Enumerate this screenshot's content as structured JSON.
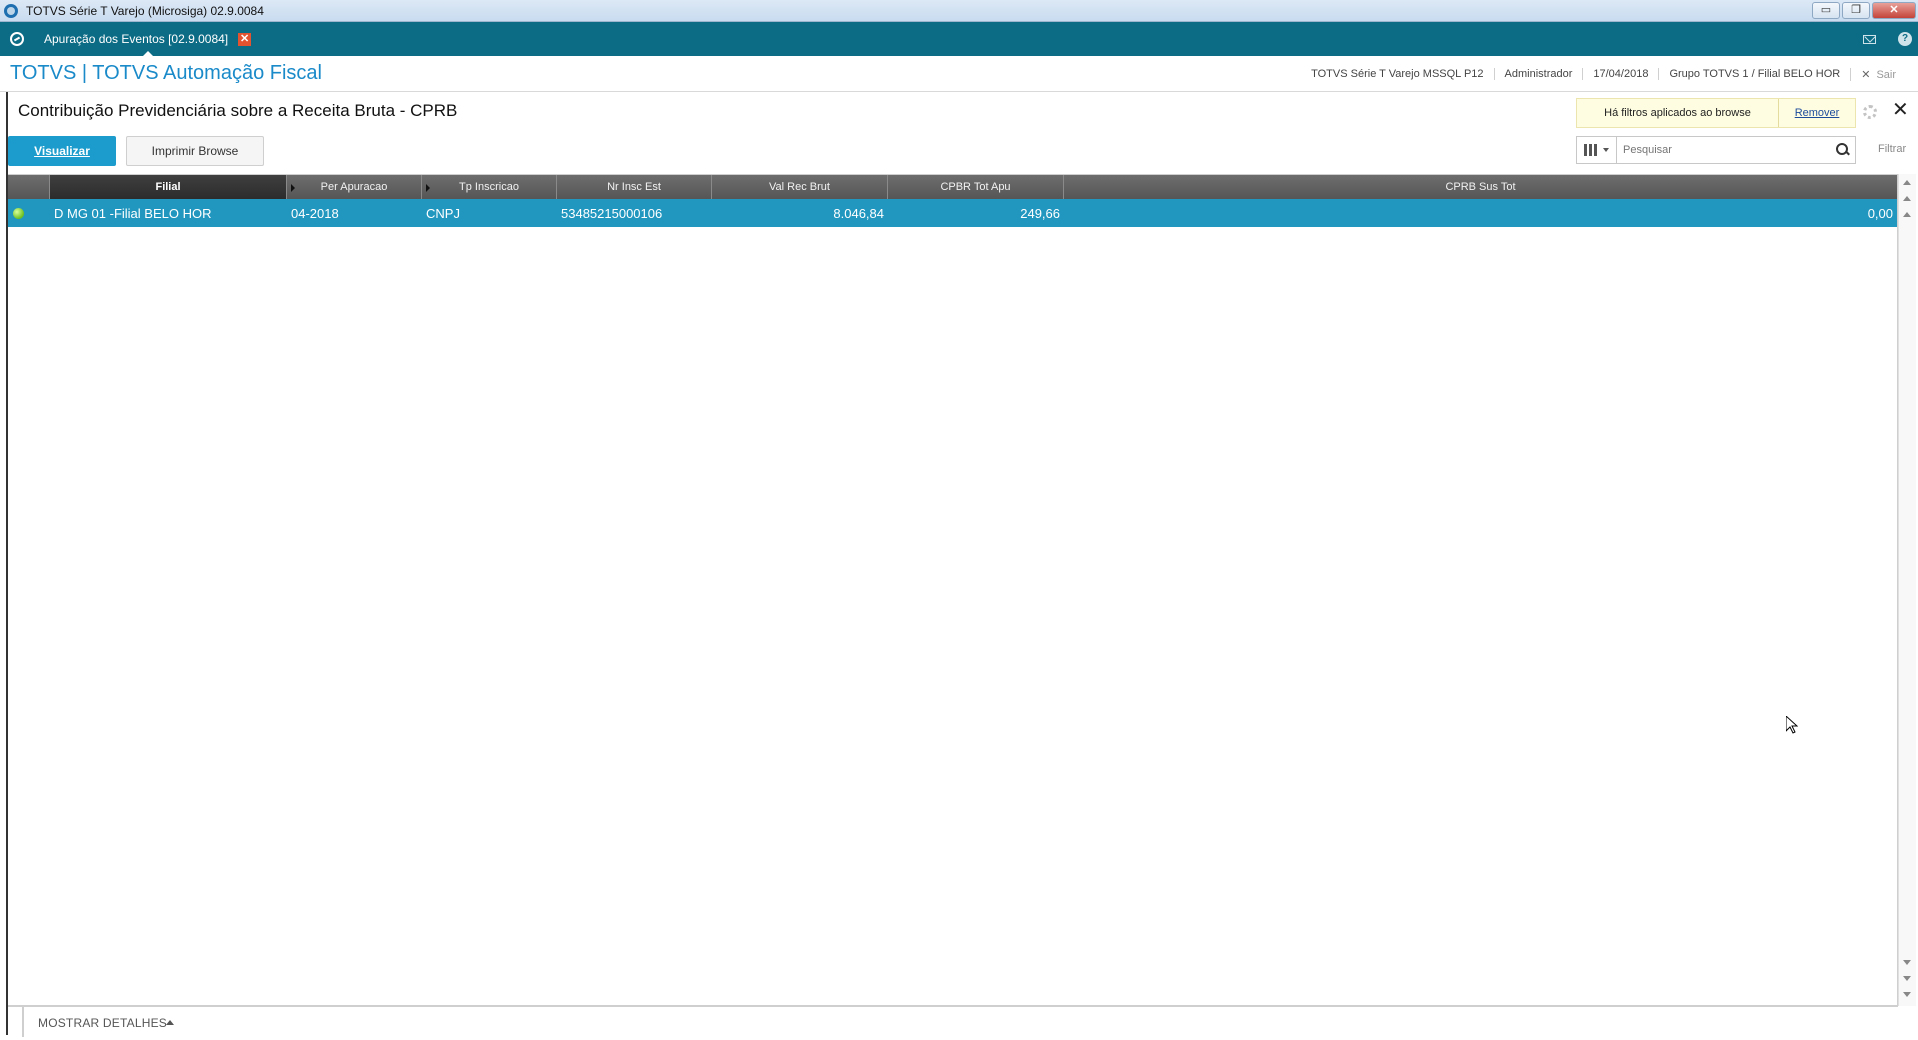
{
  "window": {
    "title": "TOTVS Série T Varejo (Microsiga) 02.9.0084",
    "min": "▭",
    "max": "❐",
    "close": "✕"
  },
  "tabbar": {
    "tab_label": "Apuração dos Eventos [02.9.0084]",
    "tab_close": "✕"
  },
  "header": {
    "brand": "TOTVS | TOTVS Automação Fiscal",
    "environment": "TOTVS Série T Varejo MSSQL P12",
    "user": "Administrador",
    "date": "17/04/2018",
    "branch": "Grupo TOTVS 1 / Filial BELO HOR",
    "logout_icon": "✕",
    "logout": "Sair"
  },
  "page": {
    "title": "Contribuição Previdenciária sobre a Receita Bruta - CPRB",
    "close": "✕",
    "filter_notice": "Há filtros aplicados ao browse",
    "filter_remove": "Remover",
    "btn_view": "Visualizar",
    "btn_print": "Imprimir Browse",
    "search_placeholder": "Pesquisar",
    "filter_label": "Filtrar"
  },
  "grid": {
    "columns": [
      "",
      "Filial",
      "Per Apuracao",
      "Tp Inscricao",
      "Nr Insc Est",
      "Val Rec Brut",
      "CPBR Tot Apu",
      "CPRB Sus Tot"
    ],
    "rows": [
      {
        "status": "green",
        "filial": "D MG 01 -Filial BELO HOR",
        "per_apuracao": "04-2018",
        "tp_inscricao": "CNPJ",
        "nr_insc_est": "53485215000106",
        "val_rec_brut": "8.046,84",
        "cpbr_tot_apu": "249,66",
        "cprb_sus_tot": "0,00"
      }
    ]
  },
  "footer": {
    "details_label": "MOSTRAR DETALHES"
  },
  "colors": {
    "tabbar": "#0d6c85",
    "brand": "#1a8ac9",
    "selected_row": "#2197bf",
    "primary_button": "#1c9ccc",
    "status_ok": "#6bbf1f"
  }
}
